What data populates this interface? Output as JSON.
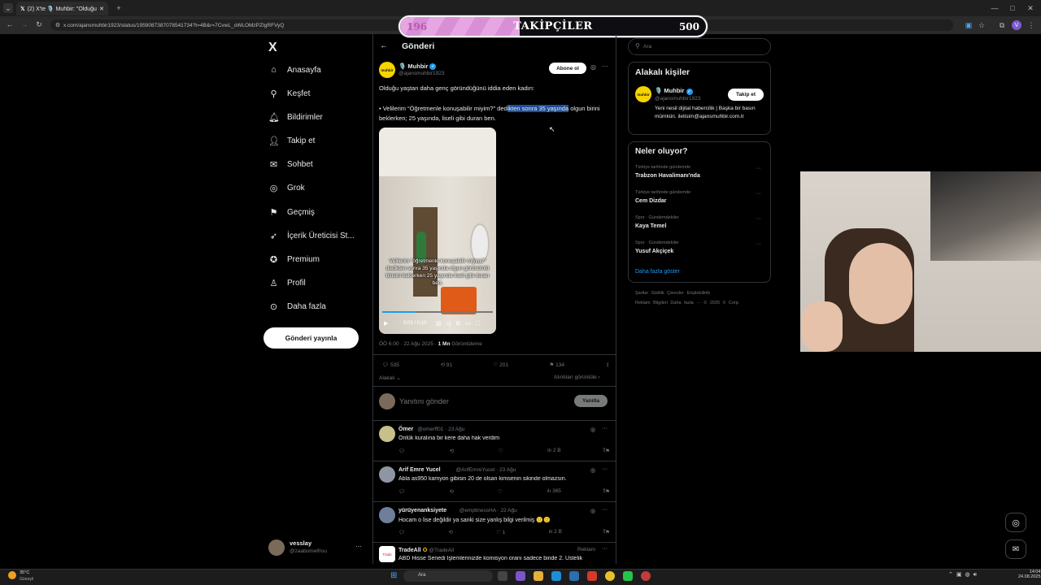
{
  "browser": {
    "tabs": [
      {
        "label": "(2) X'te 🎙️ Muhbir: \"Olduğu y..."
      }
    ],
    "new_tab": "+",
    "url": "x.com/ajansmuhbir1923/status/1959087387078541734?t=4B&r=7CvwL_oWLOMzPZIgRFVyQ",
    "window_controls": [
      "—",
      "□",
      "✕"
    ]
  },
  "followers_overlay": {
    "current": "196",
    "label": "TAKİPÇİLER",
    "goal": "500",
    "progress": 0.392
  },
  "sidebar": {
    "logo": "X",
    "items": [
      {
        "label": "Anasayfa",
        "icon": "home-icon"
      },
      {
        "label": "Keşfet",
        "icon": "search-icon"
      },
      {
        "label": "Bildirimler",
        "icon": "bell-icon"
      },
      {
        "label": "Takip et",
        "icon": "follow-icon"
      },
      {
        "label": "Sohbet",
        "icon": "chat-icon"
      },
      {
        "label": "Grok",
        "icon": "grok-icon"
      },
      {
        "label": "Geçmiş",
        "icon": "bookmark-icon"
      },
      {
        "label": "İçerik Üreticisi St...",
        "icon": "rocket-icon"
      },
      {
        "label": "Premium",
        "icon": "premium-icon"
      },
      {
        "label": "Profil",
        "icon": "person-icon"
      },
      {
        "label": "Daha fazla",
        "icon": "more-circle-icon"
      }
    ],
    "post_button": "Gönderi yayınla",
    "account": {
      "name": "vesslay",
      "handle": "@zaabumelfruu",
      "menu": "···"
    }
  },
  "post": {
    "header_title": "Gönderi",
    "author_name": "🎙️ Muhbir",
    "author_handle": "@ajansmuhbir1923",
    "avatar_text": "muhbir",
    "subscribe_button": "Abone ol",
    "text_line1": "Olduğu yaştan daha genç göründüğünü iddia eden kadın:",
    "text_part_a": "• Velilerim “Öğretmenle konuşabilir miyim?” ded",
    "text_highlight": "ikten sonra 35 yaşında",
    "text_part_b": "olgun birini beklerken; 25 yaşında, liseli gibi duran ben.",
    "video_caption": "Velilerim “öğretmenle konuşabilir miyim?” dedikten sonra 35 yaşında olgun görünümlü birisini beklerken 25 yaşında liseli gibi duran ben.",
    "video_time": "0:03 / 0:10",
    "meta": "ÖÖ 6:00 · 22 Ağu 2025 · ",
    "views": "1 Mn",
    "views_label": "Görüntüleme",
    "stats": {
      "replies": "535",
      "reposts": "91",
      "likes": "201",
      "bookmarks": "134"
    },
    "relevant": "Alakalı ⌄",
    "quotes": "Alıntıları görüntüle ›",
    "reply_placeholder": "Yanıtını gönder",
    "reply_button": "Yanıtla"
  },
  "replies": [
    {
      "name": "Ömer",
      "handle": "@omerff01 · 23 Ağu",
      "text": "Önlük kuralına bir kere daha hak verdim",
      "likes": "",
      "views": "2 B",
      "avatar_color": "#c7c08a"
    },
    {
      "name": "Arif Emre Yucel",
      "handle": "@ArifEmreYucel · 23 Ağu",
      "text": "Abla as950 kamyon gibisin 20 de olsan kimsenin sikinde olmazsın.",
      "likes": "",
      "views": "365",
      "avatar_color": "#8f96a3"
    },
    {
      "name": "yürüyenanksiyete",
      "handle": "@emptinessHA · 22 Ağu",
      "text": "Hocam o lise değildir ya sanki size yanlış bilgi verilmiş 🙂🙂",
      "likes": "1",
      "views": "2 B",
      "avatar_color": "#6f7f9a"
    }
  ],
  "ad": {
    "name": "TradeAll",
    "handle": "@TradeAll",
    "tag": "Reklam",
    "text": "ABD Hisse Senedi İşlemlerinizde komisyon oranı sadece binde 2. Üstelik"
  },
  "right": {
    "search_placeholder": "Ara",
    "related_title": "Alakalı kişiler",
    "related_name": "🎙️ Muhbir",
    "related_handle": "@ajansmuhbir1923",
    "related_follow": "Takip et",
    "related_bio": "Yeni nesil dijital habercilik | Başka bir basın mümkün. iletisim@ajansmuhbir.com.tr",
    "trends_title": "Neler oluyor?",
    "trends": [
      {
        "context": "Türkiye tarihinde gündemde",
        "name": "Trabzon Havalimanı'nda"
      },
      {
        "context": "Türkiye tarihinde gündemde",
        "name": "Cem Dizdar"
      },
      {
        "context": "Spor · Gündemdekiler",
        "name": "Kaya Temel"
      },
      {
        "context": "Spor · Gündemdekiler",
        "name": "Yusuf Akçiçek"
      }
    ],
    "show_more": "Daha fazla göster",
    "footer_line1": "Şartlar   Gizlilik   Çerezler   Erişilebilirlik",
    "footer_line2": "Reklam Bilgileri   Daha fazla ···   © 2025 X Corp."
  },
  "taskbar": {
    "weather": "35°C",
    "weather_sub": "Güneşli",
    "search": "Ara",
    "time": "14:04",
    "date": "24.08.2025"
  },
  "colors": {
    "accent": "#1d9bf0",
    "highlight": "#1f4e9c",
    "overlay_fill": "#e6a6e2"
  }
}
